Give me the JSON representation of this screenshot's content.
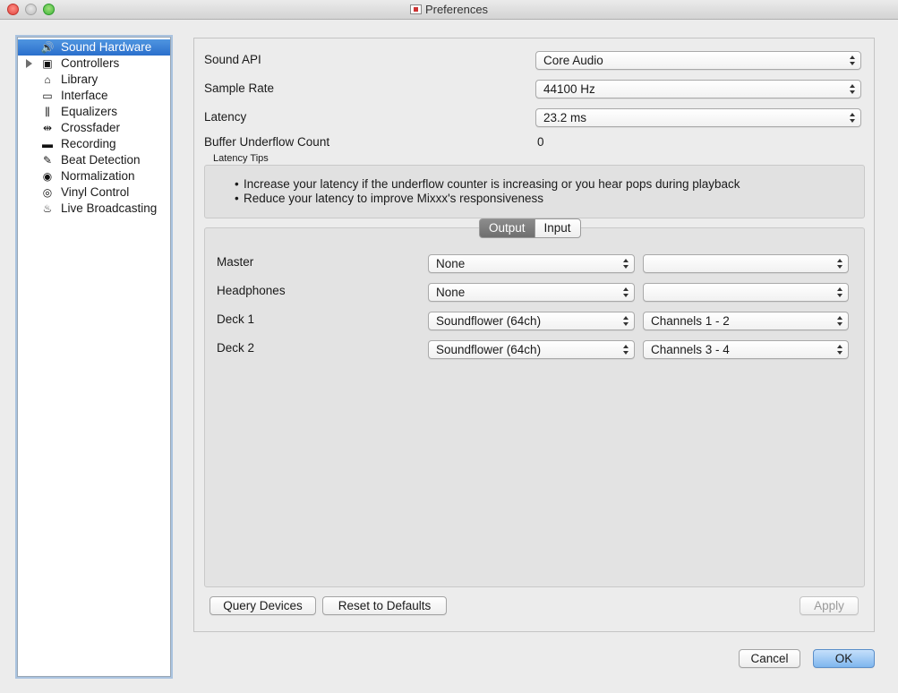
{
  "window": {
    "title": "Preferences"
  },
  "sidebar": {
    "items": [
      {
        "label": "Sound Hardware",
        "icon": "speaker-icon",
        "glyph": "🔊",
        "selected": true
      },
      {
        "label": "Controllers",
        "icon": "controller-icon",
        "glyph": "▣",
        "expandable": true
      },
      {
        "label": "Library",
        "icon": "library-icon",
        "glyph": "⌂"
      },
      {
        "label": "Interface",
        "icon": "monitor-icon",
        "glyph": "▭"
      },
      {
        "label": "Equalizers",
        "icon": "equalizer-icon",
        "glyph": "⫼"
      },
      {
        "label": "Crossfader",
        "icon": "crossfader-icon",
        "glyph": "⇹"
      },
      {
        "label": "Recording",
        "icon": "recording-icon",
        "glyph": "▬"
      },
      {
        "label": "Beat Detection",
        "icon": "beat-detection-icon",
        "glyph": "✎"
      },
      {
        "label": "Normalization",
        "icon": "normalization-icon",
        "glyph": "◉"
      },
      {
        "label": "Vinyl Control",
        "icon": "vinyl-icon",
        "glyph": "◎"
      },
      {
        "label": "Live Broadcasting",
        "icon": "broadcast-icon",
        "glyph": "♨"
      }
    ]
  },
  "settings": {
    "sound_api": {
      "label": "Sound API",
      "value": "Core Audio"
    },
    "sample_rate": {
      "label": "Sample Rate",
      "value": "44100 Hz"
    },
    "latency": {
      "label": "Latency",
      "value": "23.2 ms"
    },
    "buffer_underflow": {
      "label": "Buffer Underflow Count",
      "value": "0"
    }
  },
  "latency_tips": {
    "title": "Latency Tips",
    "lines": [
      "Increase your latency if the underflow counter is increasing or you hear pops during playback",
      "Reduce your latency to improve Mixxx's responsiveness"
    ]
  },
  "tabs": {
    "output": "Output",
    "input": "Input",
    "active": "Output"
  },
  "outputs": [
    {
      "label": "Master",
      "device": "None",
      "channels": ""
    },
    {
      "label": "Headphones",
      "device": "None",
      "channels": ""
    },
    {
      "label": "Deck 1",
      "device": "Soundflower (64ch)",
      "channels": "Channels 1 - 2"
    },
    {
      "label": "Deck 2",
      "device": "Soundflower (64ch)",
      "channels": "Channels 3 - 4"
    }
  ],
  "buttons": {
    "query_devices": "Query Devices",
    "reset_defaults": "Reset to Defaults",
    "apply": "Apply",
    "cancel": "Cancel",
    "ok": "OK"
  }
}
